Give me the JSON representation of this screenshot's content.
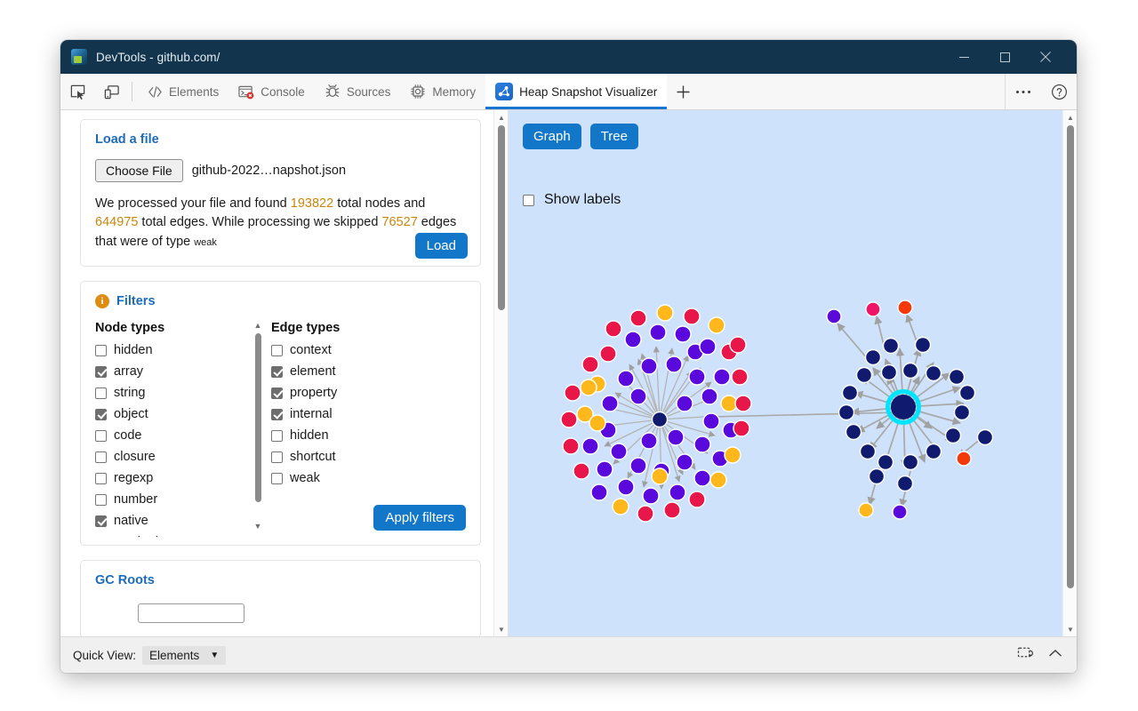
{
  "window": {
    "title": "DevTools - github.com/",
    "app_icon": "devtools-app-icon",
    "minimize_label": "Minimize",
    "maximize_label": "Maximize",
    "close_label": "Close"
  },
  "toolbar": {
    "inspect_label": "Inspect element",
    "device_label": "Toggle device emulation",
    "more_label": "More tools",
    "help_label": "Help"
  },
  "tabs": [
    {
      "label": "Elements",
      "icon": "code-brackets-icon",
      "active": false
    },
    {
      "label": "Console",
      "icon": "console-error-icon",
      "active": false
    },
    {
      "label": "Sources",
      "icon": "bug-icon",
      "active": false
    },
    {
      "label": "Memory",
      "icon": "chip-icon",
      "active": false
    },
    {
      "label": "Heap Snapshot Visualizer",
      "icon": "graph-nodes-icon",
      "active": true
    }
  ],
  "tab_add_label": "+",
  "load_file": {
    "title": "Load a file",
    "choose_button": "Choose File",
    "file_name": "github-2022…napshot.json",
    "message_parts": {
      "p1": "We processed your file and found ",
      "nodes": "193822",
      "p2": " total nodes and ",
      "edges": "644975",
      "p3": " total edges. While processing we skipped ",
      "skipped": "76527",
      "p4": " edges that were of type ",
      "skipped_type": "weak"
    },
    "load_button": "Load"
  },
  "filters": {
    "title": "Filters",
    "info_icon": "i",
    "node_types_header": "Node types",
    "edge_types_header": "Edge types",
    "node_types": [
      {
        "label": "hidden",
        "checked": false
      },
      {
        "label": "array",
        "checked": true
      },
      {
        "label": "string",
        "checked": false
      },
      {
        "label": "object",
        "checked": true
      },
      {
        "label": "code",
        "checked": false
      },
      {
        "label": "closure",
        "checked": false
      },
      {
        "label": "regexp",
        "checked": false
      },
      {
        "label": "number",
        "checked": false
      },
      {
        "label": "native",
        "checked": true
      },
      {
        "label": "synthetic",
        "checked": true
      }
    ],
    "edge_types": [
      {
        "label": "context",
        "checked": false
      },
      {
        "label": "element",
        "checked": true
      },
      {
        "label": "property",
        "checked": true
      },
      {
        "label": "internal",
        "checked": true
      },
      {
        "label": "hidden",
        "checked": false
      },
      {
        "label": "shortcut",
        "checked": false
      },
      {
        "label": "weak",
        "checked": false
      }
    ],
    "apply_button": "Apply filters"
  },
  "gc_roots": {
    "title": "GC Roots"
  },
  "graph_panel": {
    "graph_button": "Graph",
    "tree_button": "Tree",
    "show_labels_label": "Show labels",
    "show_labels_checked": false,
    "background_color": "#cfe2fb",
    "selected_ring_color": "#00e5ff",
    "node_colors": {
      "root": "#101a6e",
      "crimson": "#e8174a",
      "violet": "#5a09dd",
      "gold": "#ffb81c",
      "orange": "#f4380a",
      "navy": "#101a6e"
    },
    "edge_color": "#a8a8a8"
  },
  "statusbar": {
    "quick_view_label": "Quick View:",
    "quick_view_value": "Elements",
    "quick_view_caret": "▼",
    "screencast_icon": "screencast-icon",
    "expand_icon": "chevron-up-icon"
  }
}
